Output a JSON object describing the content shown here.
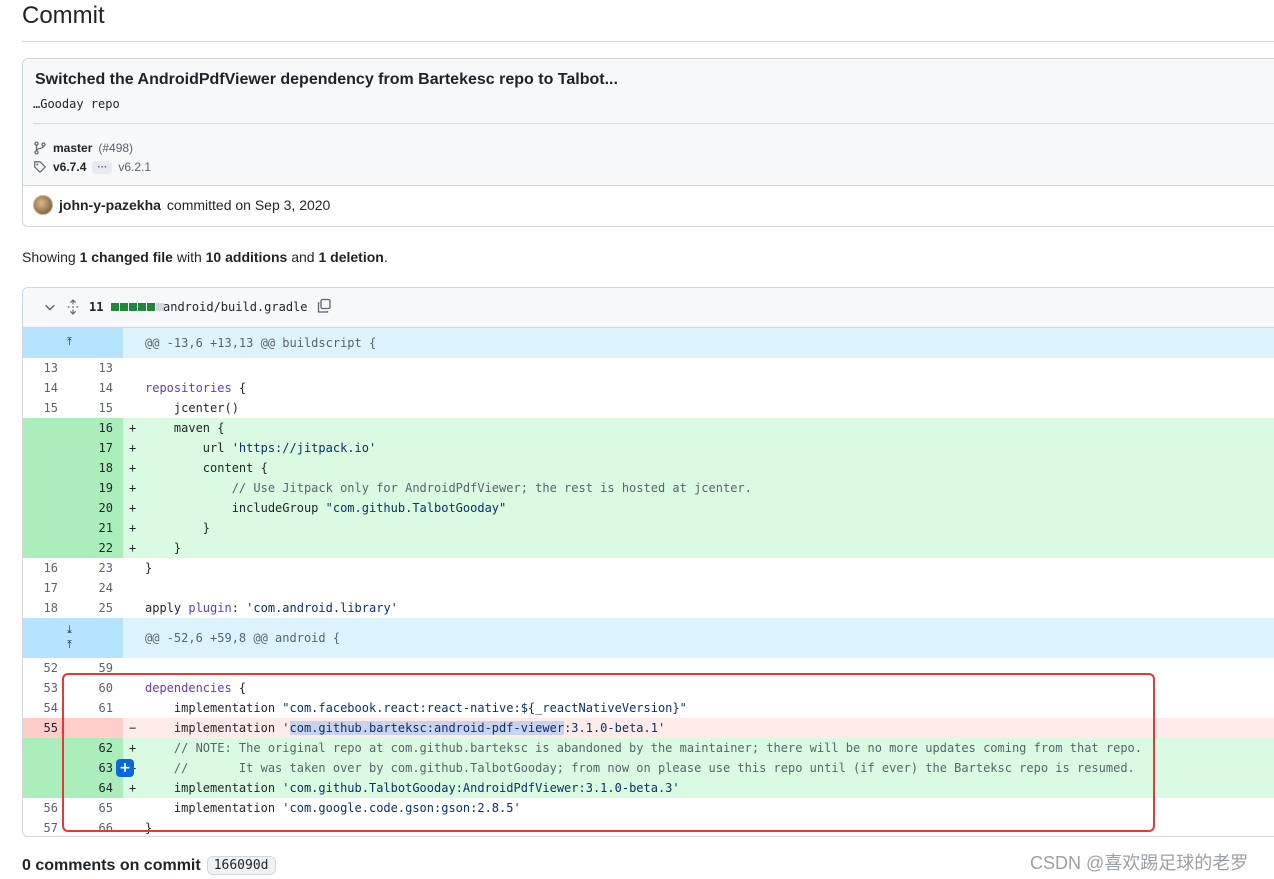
{
  "page_title": "Commit",
  "commit": {
    "message": "Switched the AndroidPdfViewer dependency from Bartekesc repo to Talbot...",
    "description": "…Gooday repo",
    "branch": "master",
    "pr": "(#498)",
    "tag_main": "v6.7.4",
    "tag_ellipsis": "···",
    "tag_other": "v6.2.1",
    "author": "john-y-pazekha",
    "committed_text": "committed on Sep 3, 2020"
  },
  "summary": {
    "prefix": "Showing ",
    "files": "1 changed file",
    "with": " with ",
    "additions": "10 additions",
    "and": " and ",
    "deletions": "1 deletion",
    "suffix": "."
  },
  "file": {
    "changes": "11",
    "path": "android/build.gradle",
    "diffstat_colors": [
      "#1f883d",
      "#1f883d",
      "#1f883d",
      "#1f883d",
      "#1f883d",
      "#d0d7de"
    ]
  },
  "hunks": {
    "h1": "@@ -13,6 +13,13 @@ buildscript {",
    "h2": "@@ -52,6 +59,8 @@ android {"
  },
  "comments": {
    "label": "0 comments on commit",
    "sha": "166090d"
  },
  "watermark": "CSDN @喜欢踢足球的老罗",
  "colors": {
    "add_bg": "#dafbe1",
    "del_bg": "#ffebe9",
    "hunk_bg": "#ddf4ff",
    "highlight_box": "#e53935"
  }
}
